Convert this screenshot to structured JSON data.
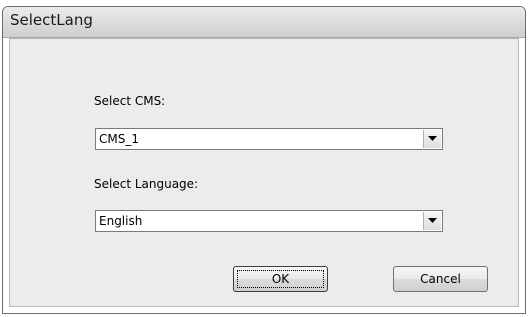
{
  "window": {
    "title": "SelectLang"
  },
  "form": {
    "cms_label": "Select CMS:",
    "cms_value": "CMS_1",
    "language_label": "Select Language:",
    "language_value": "English"
  },
  "buttons": {
    "ok_label": "OK",
    "cancel_label": "Cancel"
  },
  "icons": {
    "combo_dropdown": "chevron-down-icon"
  }
}
